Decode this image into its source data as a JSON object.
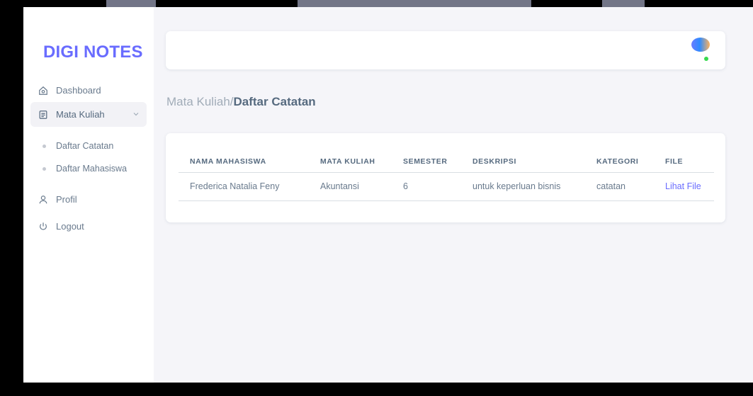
{
  "sidebar": {
    "brand": "DIGI NOTES",
    "items": [
      {
        "label": "Dashboard",
        "icon": "home-icon"
      },
      {
        "label": "Mata Kuliah",
        "icon": "document-icon",
        "expanded": true
      },
      {
        "label": "Profil",
        "icon": "user-icon"
      },
      {
        "label": "Logout",
        "icon": "power-icon"
      }
    ],
    "subitems": [
      {
        "label": "Daftar Catatan"
      },
      {
        "label": "Daftar Mahasiswa"
      }
    ]
  },
  "breadcrumb": {
    "parent": "Mata Kuliah/",
    "current": "Daftar Catatan"
  },
  "table": {
    "headers": [
      "NAMA MAHASISWA",
      "MATA KULIAH",
      "SEMESTER",
      "DESKRIPSI",
      "KATEGORI",
      "FILE"
    ],
    "rows": [
      [
        "Frederica Natalia Feny",
        "Akuntansi",
        "6",
        "untuk keperluan bisnis",
        "catatan",
        "Lihat File"
      ]
    ]
  },
  "colors": {
    "accent": "#696cff",
    "online": "#37d94e"
  }
}
